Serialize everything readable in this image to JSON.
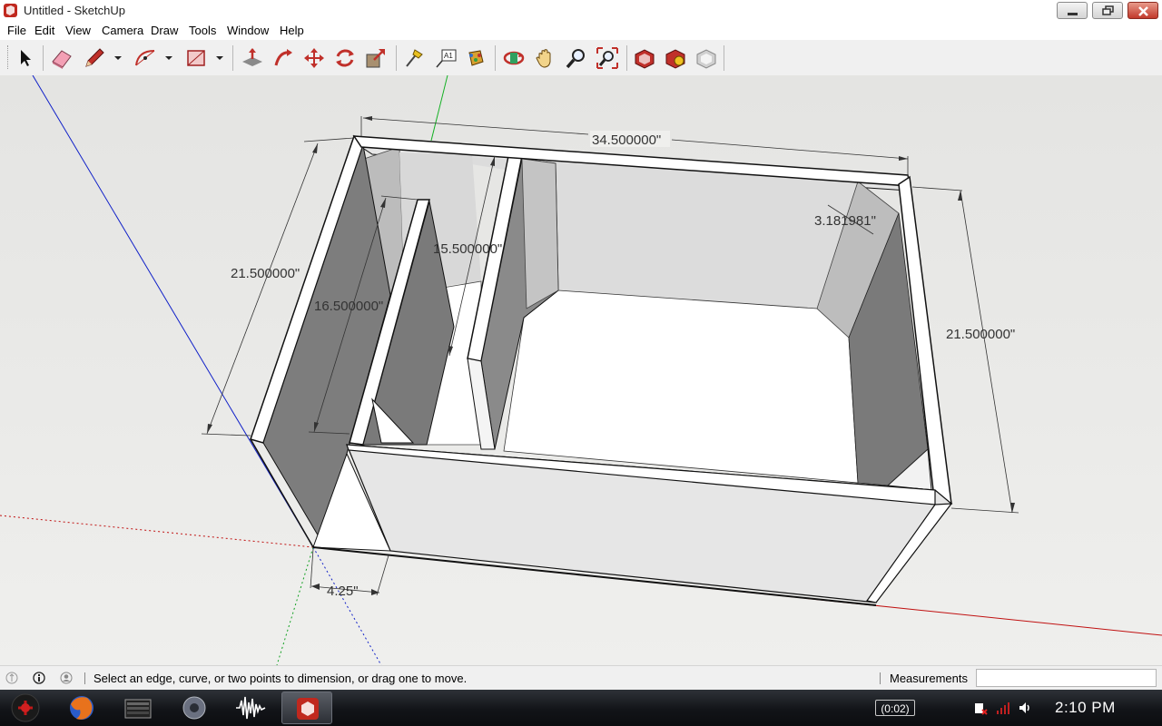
{
  "window": {
    "title": "Untitled - SketchUp"
  },
  "menu": {
    "items": [
      "File",
      "Edit",
      "View",
      "Camera",
      "Draw",
      "Tools",
      "Window",
      "Help"
    ]
  },
  "toolbar": {
    "tools": [
      "select",
      "eraser",
      "pencil",
      "arc",
      "shapes",
      "push-pull",
      "follow-me",
      "move",
      "rotate",
      "scale",
      "tape-measure",
      "text",
      "paint-bucket",
      "orbit",
      "pan",
      "zoom",
      "zoom-extents",
      "get-models",
      "share-model",
      "share-component"
    ]
  },
  "dimensions": {
    "top_width": "34.500000\"",
    "left_height": "21.500000\"",
    "right_height": "21.500000\"",
    "inner_height": "16.500000\"",
    "divider_height": "15.500000\"",
    "corner_brace": "3.181981\"",
    "panel_thickness": "4.25\""
  },
  "status": {
    "message": "Select an edge, curve, or two points to dimension, or drag one to move."
  },
  "measurements": {
    "label": "Measurements",
    "value": ""
  },
  "taskbar": {
    "timer": "(0:02)",
    "clock": "2:10 PM"
  }
}
